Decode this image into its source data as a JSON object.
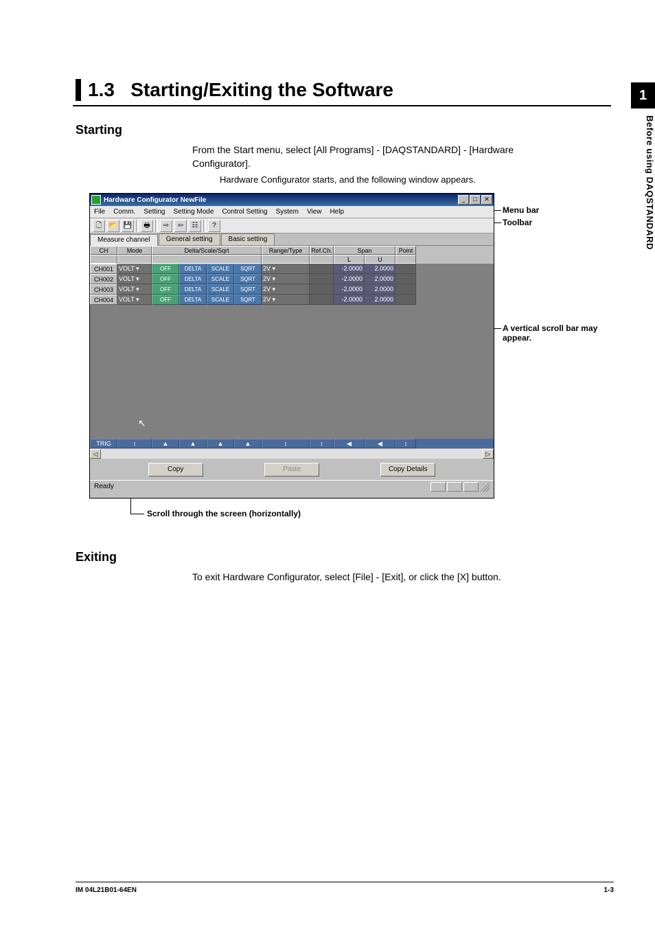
{
  "chapter_tab": "1",
  "chapter_vert": "Before using DAQSTANDARD",
  "section_number": "1.3",
  "section_title": "Starting/Exiting the Software",
  "starting": {
    "heading": "Starting",
    "p1": "From the Start menu, select [All Programs] - [DAQSTANDARD] - [Hardware Configurator].",
    "p2": "Hardware Configurator starts, and the following window appears."
  },
  "exiting": {
    "heading": "Exiting",
    "p1": "To exit Hardware Configurator, select [File] - [Exit], or click the [X] button."
  },
  "callouts": {
    "menu_bar": "Menu bar",
    "toolbar": "Toolbar",
    "vscroll": "A vertical scroll bar may appear.",
    "hscroll": "Scroll through the screen (horizontally)"
  },
  "window": {
    "title": "Hardware Configurator NewFile",
    "menus": [
      "File",
      "Comm.",
      "Setting",
      "Setting Mode",
      "Control Setting",
      "System",
      "View",
      "Help"
    ],
    "toolbar_icons": [
      "new-file-icon",
      "open-file-icon",
      "save-icon",
      "print-icon",
      "send-icon",
      "receive-icon",
      "monitor-icon",
      "help-icon"
    ],
    "toolbar_glyphs": [
      "🗋",
      "📂",
      "💾",
      "🖶",
      "⇨",
      "⇦",
      "☷",
      "?"
    ],
    "tabs": [
      "Measure channel",
      "General setting",
      "Basic setting"
    ],
    "active_tab": 0,
    "headers": {
      "ch": "CH",
      "mode": "Mode",
      "dss": "Delta/Scale/Sqrt",
      "range_type": "Range/Type",
      "ref_ch": "Ref.Ch.",
      "span": "Span",
      "span_l": "L",
      "span_u": "U",
      "point": "Point"
    },
    "rows": [
      {
        "ch": "CH001",
        "mode": "VOLT",
        "off": "OFF",
        "delta": "DELTA",
        "scale": "SCALE",
        "sqrt": "SQRT",
        "range": "2V",
        "ref": "",
        "l": "-2.0000",
        "u": "2.0000",
        "pt": ""
      },
      {
        "ch": "CH002",
        "mode": "VOLT",
        "off": "OFF",
        "delta": "DELTA",
        "scale": "SCALE",
        "sqrt": "SQRT",
        "range": "2V",
        "ref": "",
        "l": "-2.0000",
        "u": "2.0000",
        "pt": ""
      },
      {
        "ch": "CH003",
        "mode": "VOLT",
        "off": "OFF",
        "delta": "DELTA",
        "scale": "SCALE",
        "sqrt": "SQRT",
        "range": "2V",
        "ref": "",
        "l": "-2.0000",
        "u": "2.0000",
        "pt": ""
      },
      {
        "ch": "CH004",
        "mode": "VOLT",
        "off": "OFF",
        "delta": "DELTA",
        "scale": "SCALE",
        "sqrt": "SQRT",
        "range": "2V",
        "ref": "",
        "l": "-2.0000",
        "u": "2.0000",
        "pt": ""
      }
    ],
    "thumb_row_label": "TRIG",
    "thumb_symbols": [
      "↕",
      "▲",
      "▲",
      "▲",
      "▲",
      "↕",
      "↕",
      "◀",
      "◀",
      "↕"
    ],
    "buttons": {
      "copy": "Copy",
      "paste": "Paste",
      "copy_details": "Copy Details"
    },
    "status": "Ready"
  },
  "footer": {
    "left": "IM 04L21B01-64EN",
    "right": "1-3"
  }
}
